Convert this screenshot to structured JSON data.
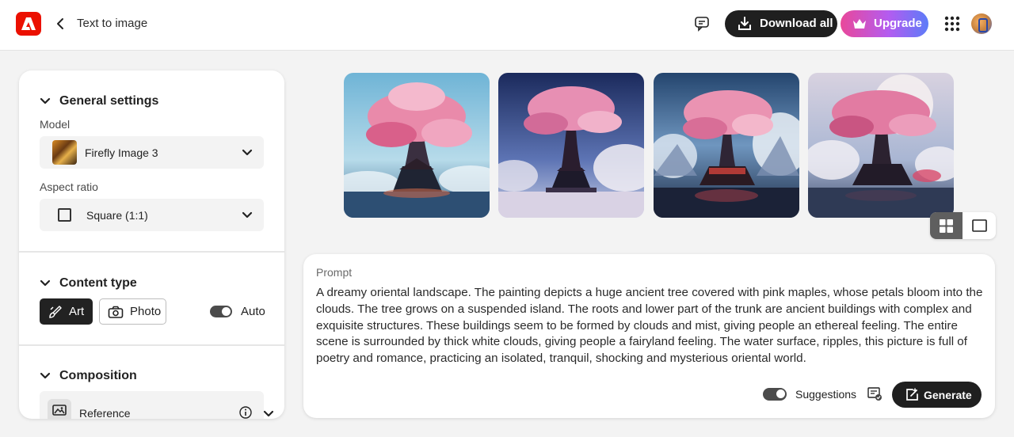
{
  "header": {
    "logo_icon": "adobe-logo-icon",
    "back_label": "Text to image",
    "download_label": "Download all",
    "upgrade_label": "Upgrade"
  },
  "sidebar": {
    "general": {
      "title": "General settings",
      "model_label": "Model",
      "model_value": "Firefly Image 3",
      "aspect_label": "Aspect ratio",
      "aspect_value": "Square (1:1)"
    },
    "content_type": {
      "title": "Content type",
      "art_label": "Art",
      "photo_label": "Photo",
      "auto_label": "Auto",
      "auto_on": true,
      "selected": "Art"
    },
    "composition": {
      "title": "Composition",
      "reference_label": "Reference"
    }
  },
  "gallery": {
    "count": 4,
    "view_mode": "grid",
    "images": [
      {
        "icon": "generated-image-1"
      },
      {
        "icon": "generated-image-2"
      },
      {
        "icon": "generated-image-3"
      },
      {
        "icon": "generated-image-4"
      }
    ]
  },
  "prompt": {
    "label": "Prompt",
    "text": "A dreamy oriental landscape. The painting depicts a huge ancient tree covered with pink maples, whose petals bloom into the clouds. The tree grows on a suspended island. The roots and lower part of the trunk are ancient buildings with complex and exquisite structures. These buildings seem to be formed by clouds and mist, giving people an ethereal feeling. The entire scene is surrounded by thick white clouds, giving people a fairyland feeling. The water surface, ripples, this picture is full of poetry and romance, practicing an isolated, tranquil, shocking and mysterious oriental world.",
    "suggestions_label": "Suggestions",
    "suggestions_on": true,
    "generate_label": "Generate"
  },
  "colors": {
    "accent_dark": "#1f1f1f",
    "adobe_red": "#eb1000",
    "upgrade_gradient_start": "#e9489a",
    "upgrade_gradient_end": "#5c7cf8"
  }
}
